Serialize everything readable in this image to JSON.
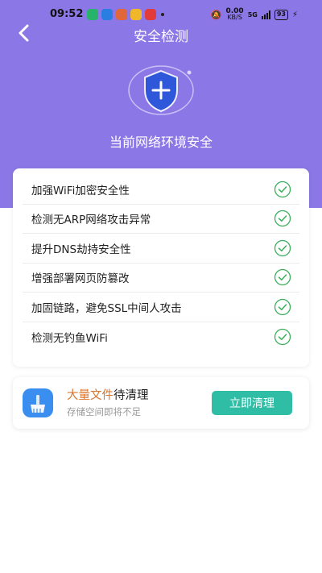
{
  "status_bar": {
    "time": "09:52",
    "net_speed_value": "0.00",
    "net_speed_unit": "KB/S",
    "network": "5G",
    "battery": "93"
  },
  "nav": {
    "title": "安全检测"
  },
  "hero": {
    "status_text": "当前网络环境安全"
  },
  "checks": [
    {
      "label": "加强WiFi加密安全性"
    },
    {
      "label": "检测无ARP网络攻击异常"
    },
    {
      "label": "提升DNS劫持安全性"
    },
    {
      "label": "增强部署网页防篡改"
    },
    {
      "label": "加固链路，避免SSL中间人攻击"
    },
    {
      "label": "检测无钓鱼WiFi"
    }
  ],
  "clean": {
    "title_highlight": "大量文件",
    "title_rest": "待清理",
    "subtitle": "存储空间即将不足",
    "button_label": "立即清理"
  },
  "colors": {
    "hero_bg": "#8b78e6",
    "shield": "#2f57d9",
    "check_green": "#3aae5a",
    "button_teal": "#2fbea5",
    "highlight_orange": "#d8752e"
  }
}
